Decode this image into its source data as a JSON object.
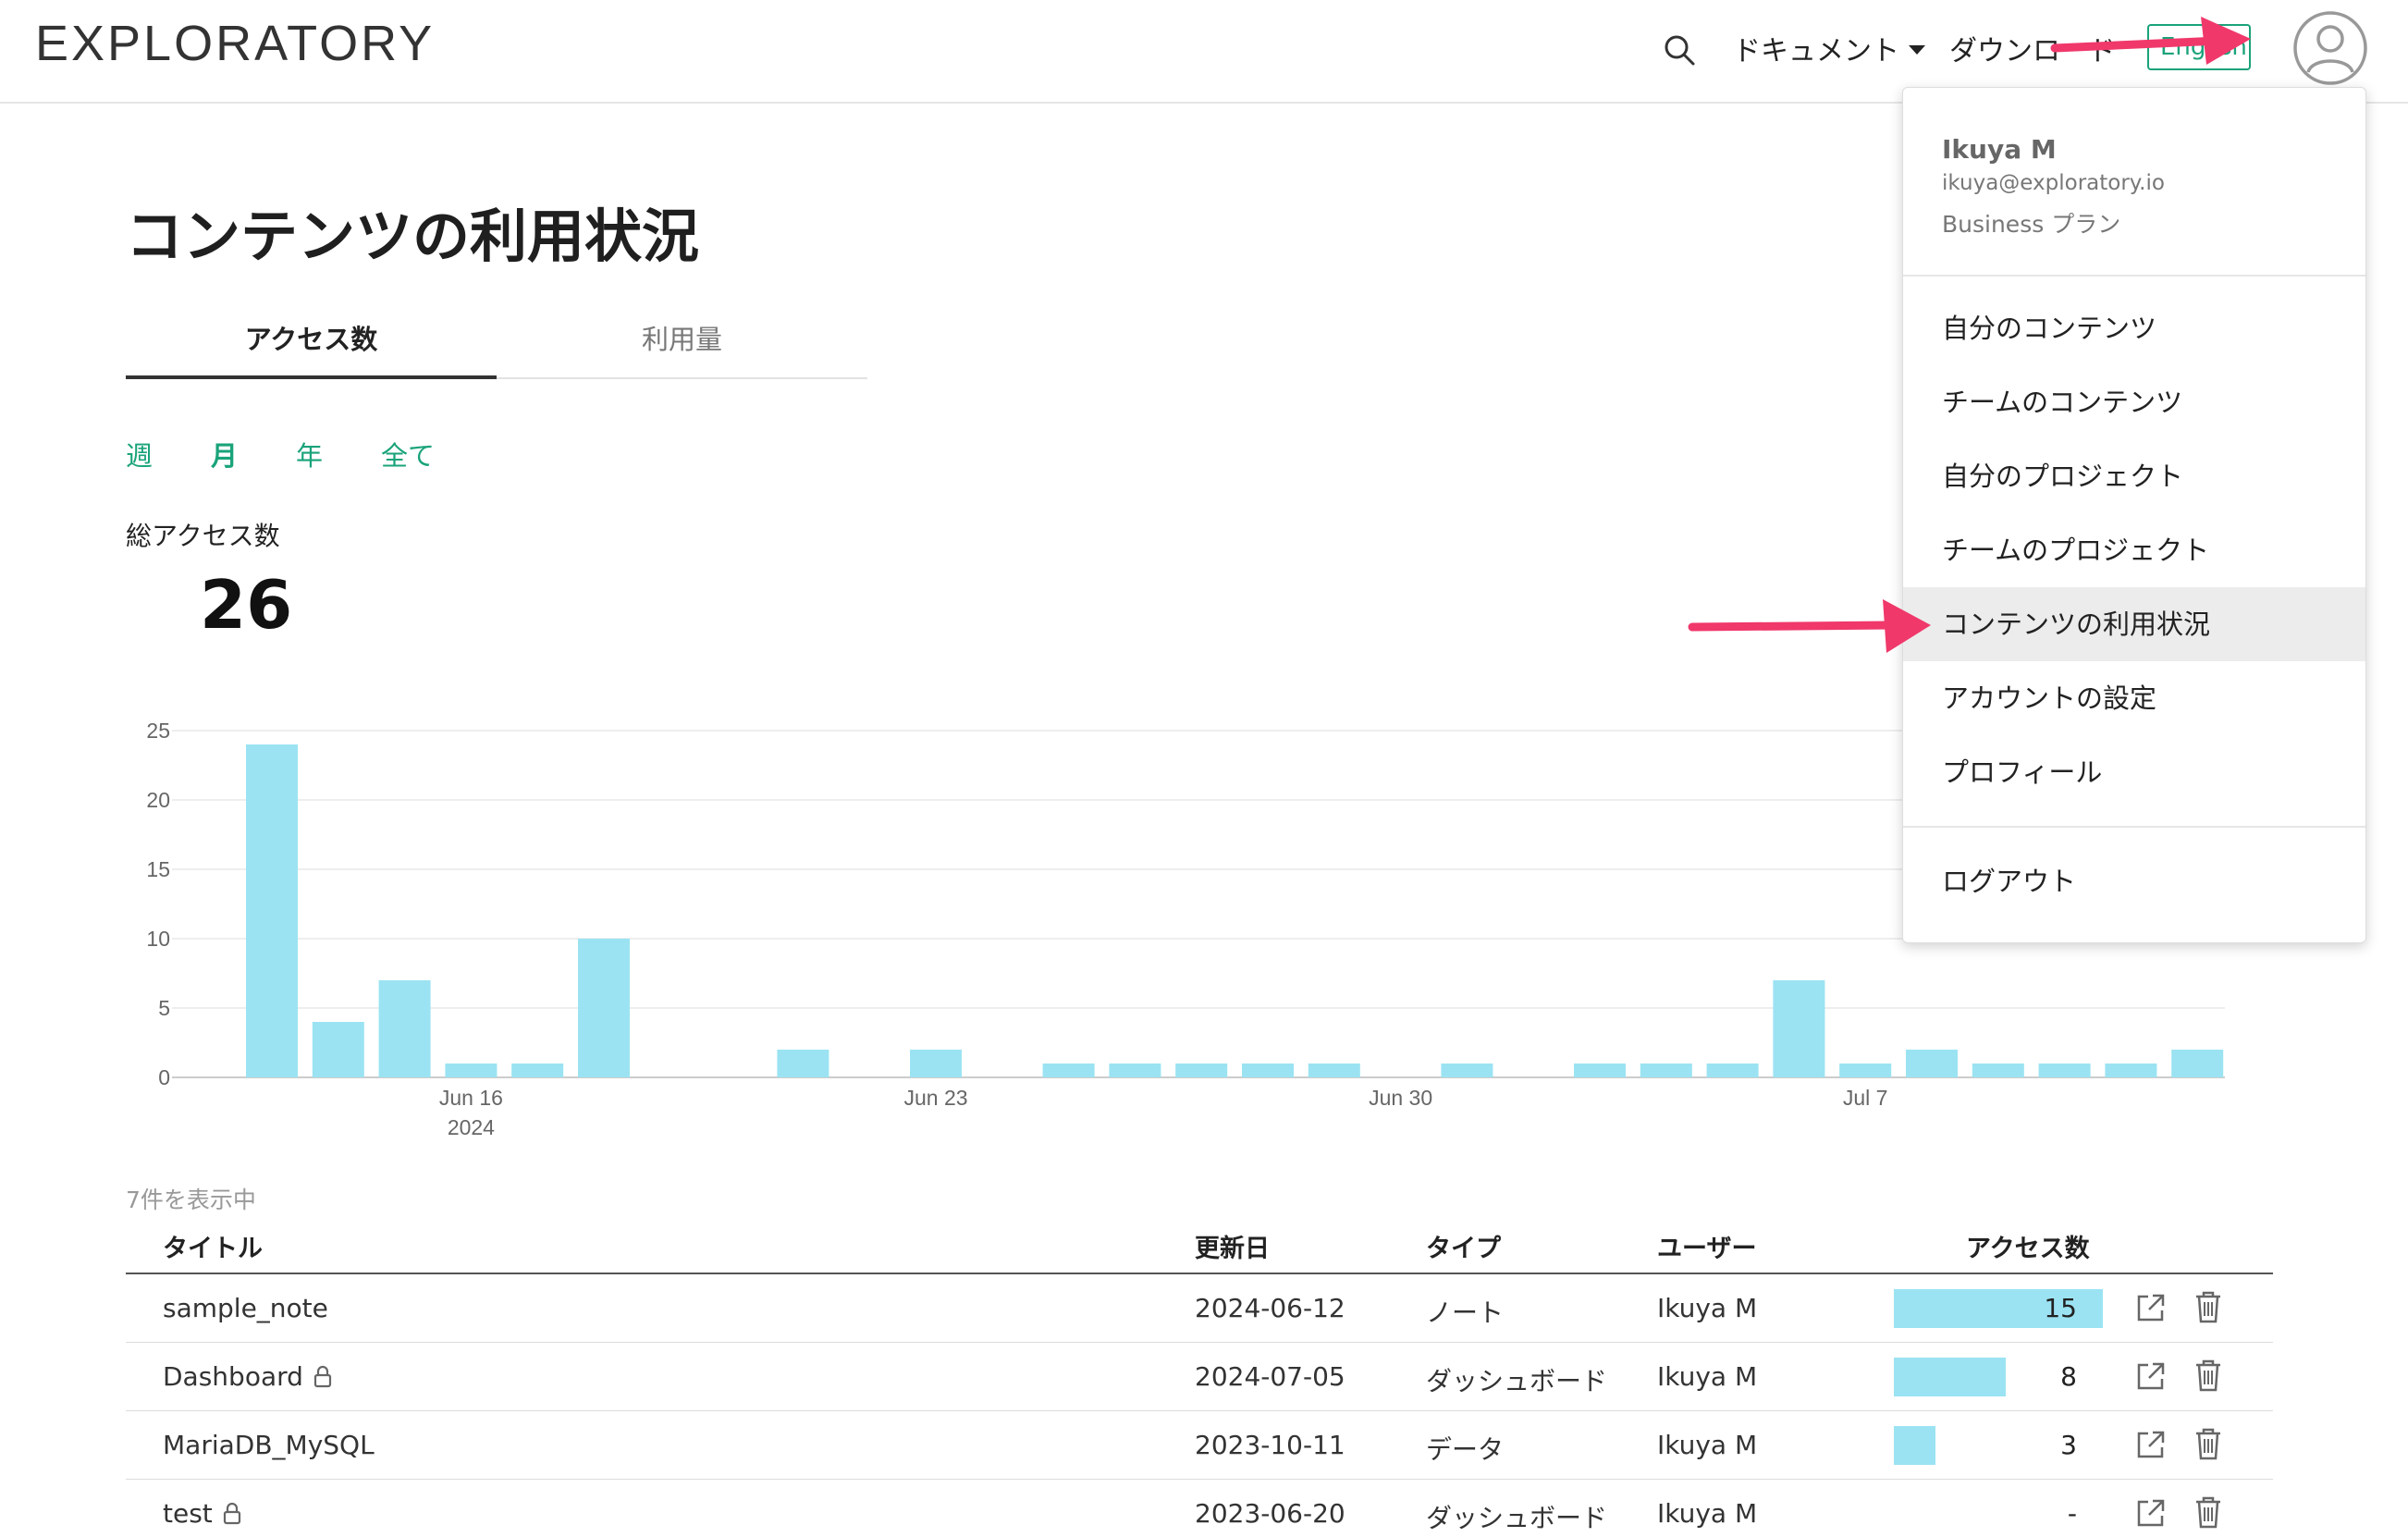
{
  "header": {
    "logo": "EXPLORATORY",
    "nav_docs": "ドキュメント",
    "nav_download": "ダウンロード",
    "lang_button": "English"
  },
  "page": {
    "title": "コンテンツの利用状況",
    "tabs": [
      "アクセス数",
      "利用量"
    ],
    "periods": [
      "週",
      "月",
      "年",
      "全て"
    ],
    "active_period": "月",
    "total_label": "総アクセス数",
    "total_value": "26"
  },
  "chart_data": {
    "type": "bar",
    "x": [
      "2024-06-13",
      "2024-06-14",
      "2024-06-15",
      "2024-06-16",
      "2024-06-17",
      "2024-06-18",
      "2024-06-19",
      "2024-06-20",
      "2024-06-21",
      "2024-06-22",
      "2024-06-23",
      "2024-06-24",
      "2024-06-25",
      "2024-06-26",
      "2024-06-27",
      "2024-06-28",
      "2024-06-29",
      "2024-06-30",
      "2024-07-01",
      "2024-07-02",
      "2024-07-03",
      "2024-07-04",
      "2024-07-05",
      "2024-07-06",
      "2024-07-07",
      "2024-07-08",
      "2024-07-09",
      "2024-07-10",
      "2024-07-11",
      "2024-07-12"
    ],
    "values": [
      24,
      4,
      7,
      1,
      1,
      10,
      0,
      0,
      2,
      0,
      2,
      0,
      1,
      1,
      1,
      1,
      1,
      0,
      1,
      0,
      1,
      1,
      1,
      7,
      1,
      2,
      1,
      1,
      1,
      2
    ],
    "ylim": [
      0,
      25
    ],
    "yticks": [
      "25",
      "20",
      "15",
      "10",
      "5",
      "0"
    ],
    "xticks": [
      {
        "date": "2024-06-16",
        "label": "Jun 16",
        "sublabel": "2024"
      },
      {
        "date": "2024-06-23",
        "label": "Jun 23",
        "sublabel": ""
      },
      {
        "date": "2024-06-30",
        "label": "Jun 30",
        "sublabel": ""
      },
      {
        "date": "2024-07-07",
        "label": "Jul 7",
        "sublabel": ""
      }
    ],
    "bar_color": "#9be3f2",
    "grid": true
  },
  "table": {
    "count_label": "7件を表示中",
    "headers": {
      "title": "タイトル",
      "updated": "更新日",
      "type": "タイプ",
      "user": "ユーザー",
      "access": "アクセス数"
    },
    "max_access": 15,
    "rows": [
      {
        "title": "sample_note",
        "locked": false,
        "updated": "2024-06-12",
        "type": "ノート",
        "user": "Ikuya M",
        "access": "15",
        "access_value": 15
      },
      {
        "title": "Dashboard",
        "locked": true,
        "updated": "2024-07-05",
        "type": "ダッシュボード",
        "user": "Ikuya M",
        "access": "8",
        "access_value": 8
      },
      {
        "title": "MariaDB_MySQL",
        "locked": false,
        "updated": "2023-10-11",
        "type": "データ",
        "user": "Ikuya M",
        "access": "3",
        "access_value": 3
      },
      {
        "title": "test",
        "locked": true,
        "updated": "2023-06-20",
        "type": "ダッシュボード",
        "user": "Ikuya M",
        "access": "-",
        "access_value": 0
      }
    ]
  },
  "dropdown": {
    "name": "Ikuya M",
    "email": "ikuya@exploratory.io",
    "plan": "Business プラン",
    "items": [
      "自分のコンテンツ",
      "チームのコンテンツ",
      "自分のプロジェクト",
      "チームのプロジェクト",
      "コンテンツの利用状況",
      "アカウントの設定",
      "プロフィール"
    ],
    "highlighted_item": "コンテンツの利用状況",
    "logout": "ログアウト"
  },
  "colors": {
    "accent": "#1aa37a",
    "bar": "#9be3f2",
    "annotation_arrow": "#f0386b"
  }
}
